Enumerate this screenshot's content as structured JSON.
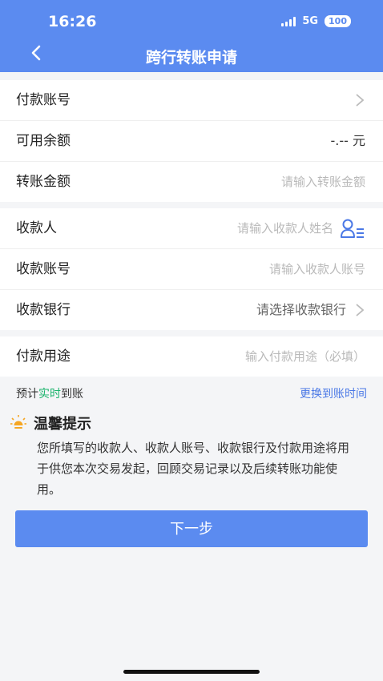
{
  "status_bar": {
    "time": "16:26",
    "network": "5G",
    "battery": "100"
  },
  "header": {
    "title": "跨行转账申请"
  },
  "section1": {
    "payer_account": {
      "label": "付款账号"
    },
    "available_balance": {
      "label": "可用余额",
      "value": "-.-- 元"
    },
    "amount": {
      "label": "转账金额",
      "placeholder": "请输入转账金额"
    }
  },
  "section2": {
    "payee": {
      "label": "收款人",
      "placeholder": "请输入收款人姓名"
    },
    "payee_account": {
      "label": "收款账号",
      "placeholder": "请输入收款人账号"
    },
    "payee_bank": {
      "label": "收款银行",
      "value": "请选择收款银行"
    }
  },
  "section3": {
    "purpose": {
      "label": "付款用途",
      "placeholder": "输入付款用途（必填）"
    }
  },
  "arrival": {
    "prefix": "预计",
    "highlight": "实时",
    "suffix": "到账",
    "change_link": "更换到账时间"
  },
  "tips": {
    "title": "温馨提示",
    "body": "您所填写的收款人、收款人账号、收款银行及付款用途将用于供您本次交易发起，回顾交易记录以及后续转账功能使用。"
  },
  "buttons": {
    "next": "下一步"
  },
  "colors": {
    "primary": "#5b8bf0",
    "link": "#4a78e6",
    "highlight": "#19b36b",
    "bulb": "#f5a623"
  }
}
